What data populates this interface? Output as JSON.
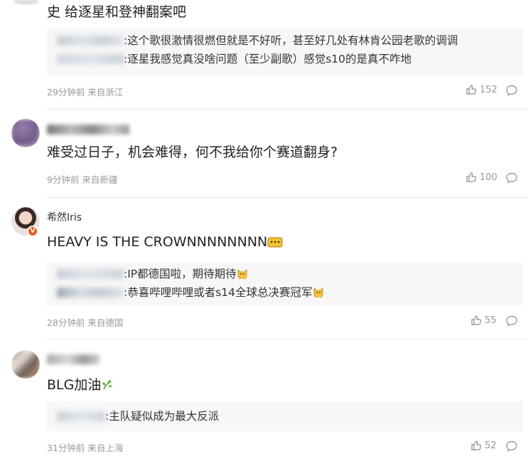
{
  "comments": [
    {
      "text": "史 给逐星和登神翻案吧",
      "replies": [
        {
          "text": ":这个歌很激情很燃但就是不好听，甚至好几处有林肯公园老歌的调调"
        },
        {
          "text": ":逐星我感觉真没啥问题（至少副歌）感觉s10的是真不咋地"
        }
      ],
      "meta": "29分钟前 来自浙江",
      "likes": "152"
    },
    {
      "text": "难受过日子，机会难得，何不我给你个赛道翻身?",
      "replies": [],
      "meta": "9分钟前 来自新疆",
      "likes": "100"
    },
    {
      "username": "希然Iris",
      "text": "HEAVY IS THE CROWNNNNNNNN",
      "replies": [
        {
          "text": ":IP都德国啦，期待期待"
        },
        {
          "text": ":恭喜哔哩哔哩或者s14全球总决赛冠军"
        }
      ],
      "meta": "28分钟前 来自德国",
      "likes": "55"
    },
    {
      "text": "BLG加油",
      "replies": [
        {
          "text": ":主队疑似成为最大反派"
        }
      ],
      "meta": "31分钟前 来自上海",
      "likes": "52"
    }
  ],
  "icons": {
    "like": "thumbs-up-icon",
    "reply": "comment-bubble-icon",
    "verified": "verified-badge-icon",
    "crown_emoji": "crown-emoji-icon",
    "cat_emoji": "cat-emoji-icon",
    "plant_emoji": "plant-emoji-icon"
  },
  "colors": {
    "meta": "#9a9a9a",
    "reply_bg": "#f7f7f7",
    "verified": "#e85a1b"
  }
}
